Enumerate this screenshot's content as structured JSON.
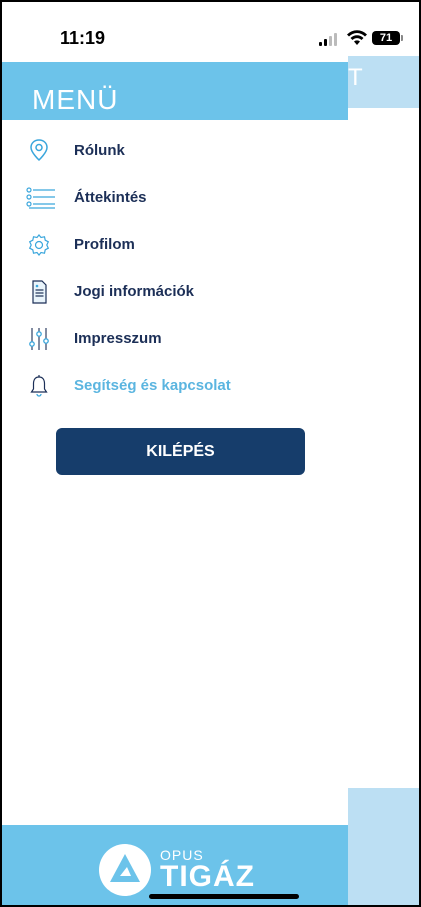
{
  "status_bar": {
    "time": "11:19",
    "battery": "71",
    "signal_icon": "cellular-signal-icon",
    "wifi_icon": "wifi-icon"
  },
  "background": {
    "header_text": "T",
    "color": "#bcdff3"
  },
  "menu": {
    "title": "MENÜ",
    "header_color": "#6cc3ea",
    "items": [
      {
        "label": "Rólunk",
        "icon": "location-pin-icon"
      },
      {
        "label": "Áttekintés",
        "icon": "list-icon"
      },
      {
        "label": "Profilom",
        "icon": "gear-icon"
      },
      {
        "label": "Jogi információk",
        "icon": "document-icon"
      },
      {
        "label": "Impresszum",
        "icon": "sliders-icon"
      },
      {
        "label": "Segítség és kapcsolat",
        "icon": "bell-icon"
      }
    ],
    "logout_label": "KILÉPÉS",
    "logout_color": "#163d6b"
  },
  "footer": {
    "brand_small": "OPUS",
    "brand_big": "TIGÁZ",
    "logo_icon": "tigaz-logo-icon"
  },
  "colors": {
    "text_primary": "#1c2f57",
    "text_highlight": "#5bb5e0"
  }
}
